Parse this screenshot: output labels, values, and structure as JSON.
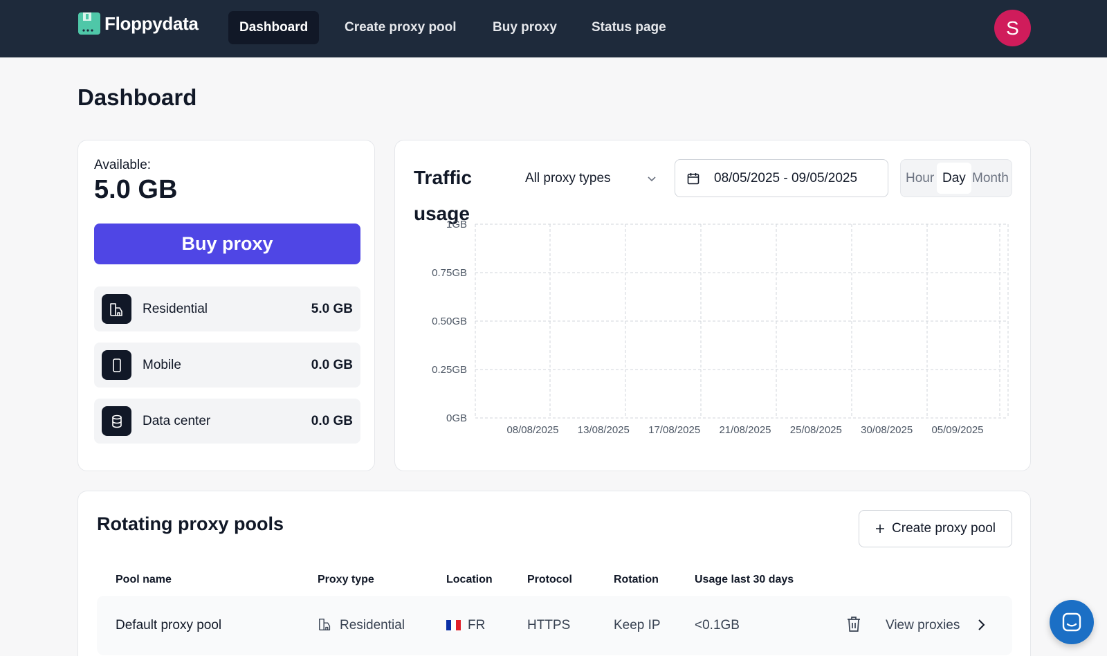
{
  "app": {
    "name": "Floppydata",
    "brand_color": "#4f46e5"
  },
  "nav": {
    "items": [
      {
        "label": "Dashboard",
        "active": true
      },
      {
        "label": "Create proxy pool",
        "active": false
      },
      {
        "label": "Buy proxy",
        "active": false
      },
      {
        "label": "Status page",
        "active": false
      }
    ],
    "avatar_initial": "S"
  },
  "page": {
    "title": "Dashboard"
  },
  "balance": {
    "label": "Available:",
    "value": "5.0 GB",
    "buy_label": "Buy proxy",
    "proxy_types": [
      {
        "name": "Residential",
        "value": "5.0 GB",
        "icon": "building-icon"
      },
      {
        "name": "Mobile",
        "value": "0.0 GB",
        "icon": "smartphone-icon"
      },
      {
        "name": "Data center",
        "value": "0.0 GB",
        "icon": "database-icon"
      }
    ]
  },
  "traffic": {
    "title": "Traffic usage",
    "proxy_filter": "All proxy types",
    "date_range": "08/05/2025 - 09/05/2025",
    "periods": [
      {
        "label": "Hour",
        "active": false
      },
      {
        "label": "Day",
        "active": true
      },
      {
        "label": "Month",
        "active": false
      }
    ]
  },
  "chart_data": {
    "type": "line",
    "title": "Traffic usage",
    "xlabel": "",
    "ylabel": "",
    "y_ticks": [
      "0GB",
      "0.25GB",
      "0.50GB",
      "0.75GB",
      "1GB"
    ],
    "ylim": [
      0,
      1
    ],
    "x_ticks": [
      "08/08/2025",
      "13/08/2025",
      "17/08/2025",
      "21/08/2025",
      "25/08/2025",
      "30/08/2025",
      "05/09/2025"
    ],
    "grid": true,
    "series": []
  },
  "pools": {
    "title": "Rotating proxy pools",
    "create_label": "Create proxy pool",
    "columns": [
      "Pool name",
      "Proxy type",
      "Location",
      "Protocol",
      "Rotation",
      "Usage last 30 days"
    ],
    "rows": [
      {
        "name": "Default proxy pool",
        "type": "Residential",
        "location": "FR",
        "protocol": "HTTPS",
        "rotation": "Keep IP",
        "usage": "<0.1GB",
        "view_label": "View proxies"
      }
    ]
  }
}
